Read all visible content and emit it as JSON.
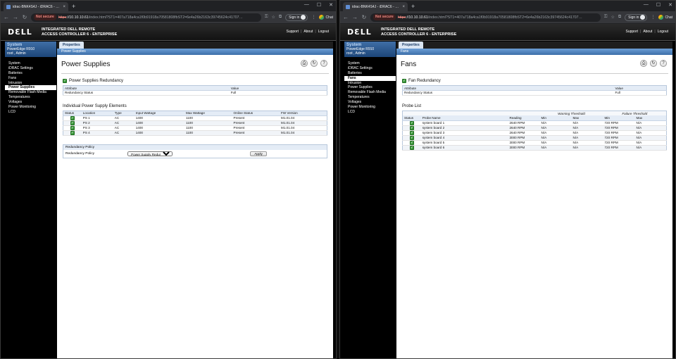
{
  "windows": {
    "left": {
      "tab_title": "idrac-BNK4S4J - iDRAC6 - Power Supplies",
      "url_not_secure": "Not secure",
      "url_proto": "https",
      "url_host": "://10.10.10.61",
      "url_rest": "/index.html?ST1=407a718a4ca1f0b91918a70581808fbST2=6e4a26b2163c39745624c41707…",
      "page_tab": "Properties",
      "sub_tab": "Power Supplies",
      "title": "Power Supplies",
      "redundancy_section": "Power Supplies Redundancy",
      "attr_headers": [
        "Attribute",
        "Value"
      ],
      "attr_rows": [
        [
          "Redundancy Status",
          "Full"
        ]
      ],
      "elements_section": "Individual Power Supply Elements",
      "ps_headers": [
        "Status",
        "Location",
        "Type",
        "Input Wattage",
        "Max Wattage",
        "Online Status",
        "FW Version"
      ],
      "ps_rows": [
        [
          "PS 1",
          "AC",
          "1400",
          "1100",
          "Present",
          "M1.01.04"
        ],
        [
          "PS 2",
          "AC",
          "1400",
          "1100",
          "Present",
          "M1.01.04"
        ],
        [
          "PS 3",
          "AC",
          "1400",
          "1100",
          "Present",
          "M1.01.04"
        ],
        [
          "PS 4",
          "AC",
          "1400",
          "1100",
          "Present",
          "M1.01.04"
        ]
      ],
      "policy_header": "Redundancy Policy",
      "policy_label": "Redundancy Policy",
      "policy_value": "Power Supply Redundancy",
      "apply_label": "Apply"
    },
    "right": {
      "tab_title": "idrac-BNK4S4J - iDRAC6 - Fans",
      "url_not_secure": "Not secure",
      "url_proto": "https",
      "url_host": "://10.10.10.61",
      "url_rest": "/index.html?ST1=407a718a4ca1f0b91918a70581808fbST2=6e4a26b2163c39745624c41707…",
      "page_tab": "Properties",
      "sub_tab": "Fans",
      "title": "Fans",
      "redundancy_section": "Fan Redundancy",
      "attr_headers": [
        "Attribute",
        "Value"
      ],
      "attr_rows": [
        [
          "Redundancy Status",
          "Full"
        ]
      ],
      "probe_section": "Probe List",
      "threshold_groups": [
        "Warning Threshold",
        "Failure Threshold"
      ],
      "probe_headers": [
        "Status",
        "Probe Name",
        "Reading",
        "Min",
        "Max",
        "Min",
        "Max"
      ],
      "probe_rows": [
        [
          "system board 1",
          "2640 RPM",
          "N/A",
          "N/A",
          "720 RPM",
          "N/A"
        ],
        [
          "system board 2",
          "2640 RPM",
          "N/A",
          "N/A",
          "720 RPM",
          "N/A"
        ],
        [
          "system board 3",
          "2640 RPM",
          "N/A",
          "N/A",
          "720 RPM",
          "N/A"
        ],
        [
          "system board 4",
          "3000 RPM",
          "N/A",
          "N/A",
          "720 RPM",
          "N/A"
        ],
        [
          "system board 5",
          "3000 RPM",
          "N/A",
          "N/A",
          "720 RPM",
          "N/A"
        ],
        [
          "system board 6",
          "3000 RPM",
          "N/A",
          "N/A",
          "720 RPM",
          "N/A"
        ]
      ]
    }
  },
  "browser": {
    "signin": "Sign in",
    "chat": "Chat",
    "new_tab": "+",
    "close_tab": "×"
  },
  "header": {
    "logo": "DƐLL",
    "product_line1": "INTEGRATED DELL REMOTE",
    "product_line2": "ACCESS CONTROLLER 6 - ENTERPRISE",
    "links": [
      "Support",
      "About",
      "Logout"
    ]
  },
  "sidebar": {
    "system_title": "System",
    "model": "PowerEdge R910",
    "user": "root , Admin",
    "items": [
      "System",
      "iDRAC Settings",
      "Batteries",
      "Fans",
      "Intrusion",
      "Power Supplies",
      "Removable Flash Media",
      "Temperatures",
      "Voltages",
      "Power Monitoring",
      "LCD"
    ]
  },
  "icons": {
    "print": "print-icon",
    "refresh": "refresh-icon",
    "help": "help-icon"
  }
}
